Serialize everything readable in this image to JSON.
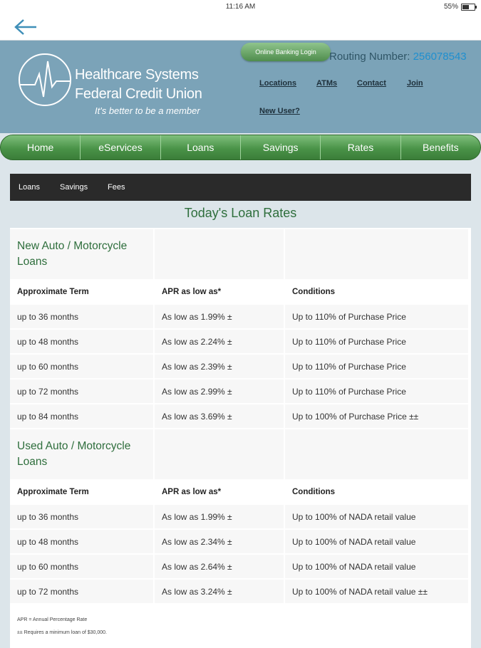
{
  "status_bar": {
    "time": "11:16 AM",
    "battery": "55%"
  },
  "header": {
    "logo_line1": "Healthcare Systems",
    "logo_line2": "Federal Credit Union",
    "tagline": "It's better to be a member",
    "online_banking_label": "Online Banking Login",
    "routing_label": "Routing Number:",
    "routing_number": "256078543",
    "links": [
      "Locations",
      "ATMs",
      "Contact",
      "Join",
      "New User?"
    ]
  },
  "nav": [
    "Home",
    "eServices",
    "Loans",
    "Savings",
    "Rates",
    "Benefits"
  ],
  "subnav": [
    "Loans",
    "Savings",
    "Fees"
  ],
  "page_title": "Today's Loan Rates",
  "new_auto": {
    "title": "New Auto / Motorcycle Loans",
    "headers": [
      "Approximate Term",
      "APR as low as*",
      "Conditions"
    ],
    "rows": [
      [
        "up to 36 months",
        "As low as 1.99% ±",
        "Up to 110% of Purchase Price"
      ],
      [
        "up to 48 months",
        "As low as 2.24% ±",
        "Up to 110% of Purchase Price"
      ],
      [
        "up to 60 months",
        "As low as 2.39% ±",
        "Up to 110% of Purchase Price"
      ],
      [
        "up to 72 months",
        "As low as 2.99% ±",
        "Up to 110% of Purchase Price"
      ],
      [
        "up to 84 months",
        "As low as 3.69% ±",
        "Up to 100% of Purchase Price ±±"
      ]
    ]
  },
  "used_auto": {
    "title": "Used Auto / Motorcycle Loans",
    "headers": [
      "Approximate Term",
      "APR as low as*",
      "Conditions"
    ],
    "rows": [
      [
        "up to 36 months",
        "As low as 1.99% ±",
        "Up to 100% of NADA retail value"
      ],
      [
        "up to 48 months",
        "As low as 2.34% ±",
        "Up to 100% of NADA retail value"
      ],
      [
        "up to 60 months",
        "As low as 2.64% ±",
        "Up to 100% of NADA retail value"
      ],
      [
        "up to 72 months",
        "As low as 3.24% ±",
        "Up to 100% of NADA retail value ±±"
      ]
    ]
  },
  "footnotes": [
    "APR = Annual Percentage Rate",
    "±± Requires a minimum loan of $30,000."
  ],
  "colors": {
    "header_bg": "#7ba3b8",
    "nav_green": "#4a9348",
    "title_green": "#2e6e3c",
    "routing_blue": "#1f8fcf"
  }
}
